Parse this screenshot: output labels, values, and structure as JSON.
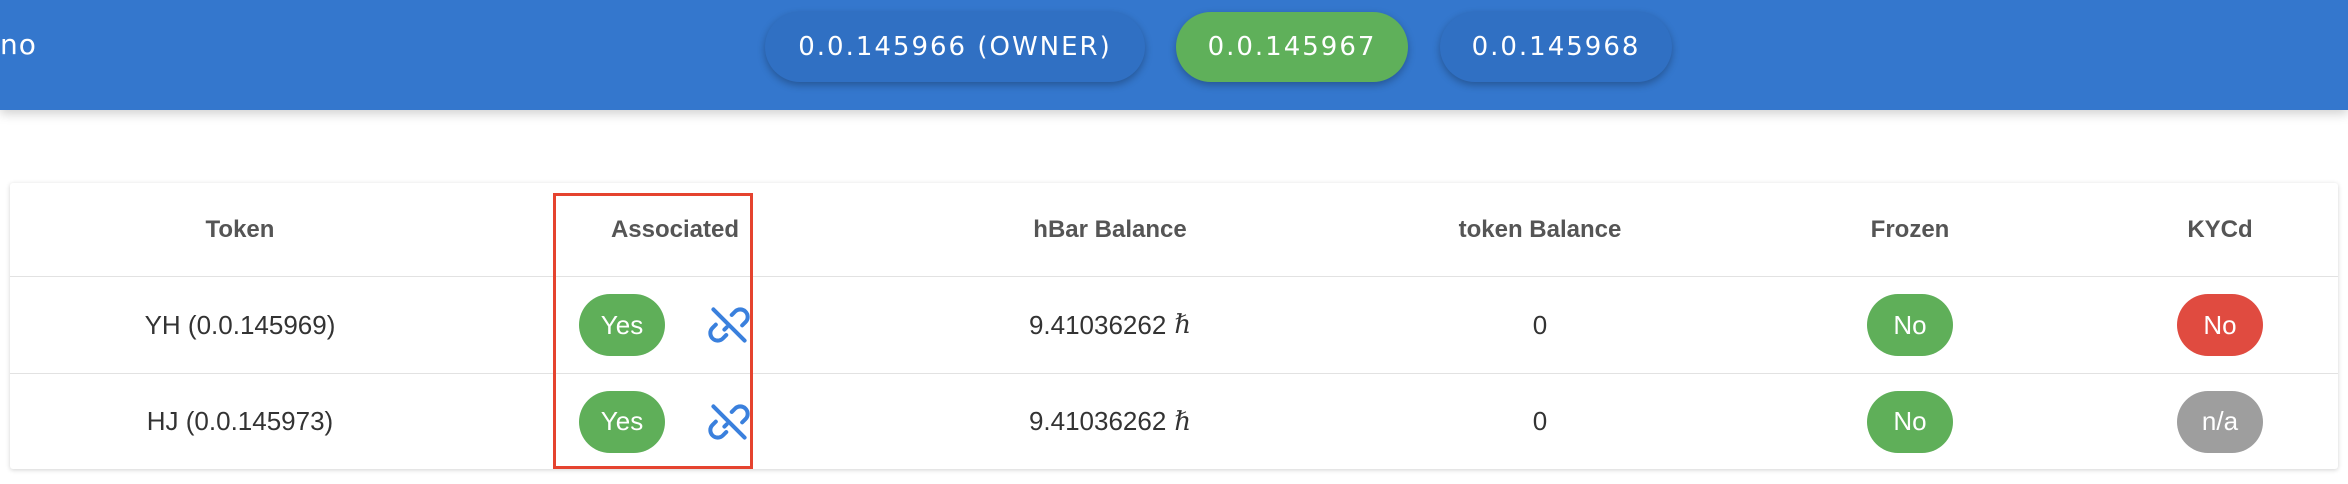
{
  "header": {
    "brand_text": "no",
    "accounts": [
      {
        "label": "0.0.145966 (OWNER)",
        "active": false
      },
      {
        "label": "0.0.145967",
        "active": true
      },
      {
        "label": "0.0.145968",
        "active": false
      }
    ]
  },
  "table": {
    "columns": [
      "Token",
      "Associated",
      "hBar Balance",
      "token Balance",
      "Frozen",
      "KYCd"
    ],
    "hbar_symbol": "ℏ",
    "rows": [
      {
        "token": "YH (0.0.145969)",
        "associated": "Yes",
        "hbar_balance": "9.41036262",
        "token_balance": "0",
        "frozen": "No",
        "kycd": "No",
        "kycd_color": "#e04b40"
      },
      {
        "token": "HJ (0.0.145973)",
        "associated": "Yes",
        "hbar_balance": "9.41036262",
        "token_balance": "0",
        "frozen": "No",
        "kycd": "n/a",
        "kycd_color": "#9e9e9e"
      }
    ]
  },
  "colors": {
    "topbar": "#3477cd",
    "green": "#5faf59",
    "red": "#e04b40",
    "grey": "#9e9e9e",
    "link_icon": "#3a80dd",
    "highlight": "#e5432f"
  },
  "icons": {
    "dissociate": "link-off-icon"
  }
}
